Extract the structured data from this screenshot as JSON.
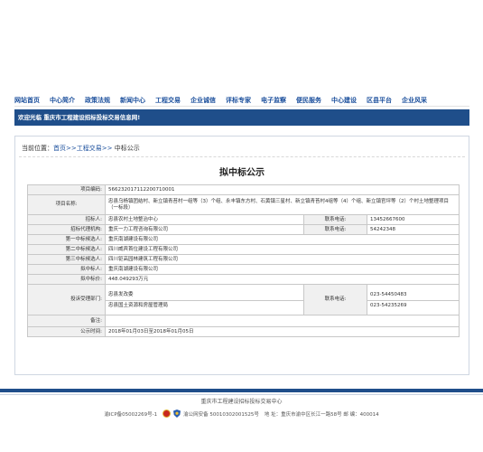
{
  "nav": {
    "items": [
      "网站首页",
      "中心简介",
      "政策法规",
      "新闻中心",
      "工程交易",
      "企业诚信",
      "评标专家",
      "电子监察",
      "便民服务",
      "中心建设",
      "区县平台",
      "企业风采"
    ]
  },
  "welcome": "欢迎光临 重庆市工程建设招标投标交易信息网!",
  "breadcrumb": {
    "prefix": "当前位置：",
    "home": "首页",
    "sep1": ">>",
    "section": "工程交易",
    "sep2": ">>",
    "current": "中标公示"
  },
  "page_title": "拟中标公示",
  "table": {
    "project_code_label": "项目编码:",
    "project_code": "566232017112200710001",
    "project_name_label": "项目名称:",
    "project_name": "忠县乌杨镇团结村、新立镇青苔村一组等（3）个组、永丰镇东方村、石黄镇三星村、新立镇青苔村4组等（4）个组、新立镇官坪等（2）个村土地整理项目（一标段）",
    "tenderer_label": "招标人:",
    "tenderer": "忠县农村土地整治中心",
    "tenderer_phone_label": "联系电话:",
    "tenderer_phone": "13452667600",
    "agency_label": "招标代理机构:",
    "agency": "重庆一力工程咨询有限公司",
    "agency_phone_label": "联系电话:",
    "agency_phone": "54242348",
    "cand1_label": "第一中标候选人:",
    "cand1": "重庆南湖建设有限公司",
    "cand2_label": "第二中标候选人:",
    "cand2": "四川威宾首位建设工程有限公司",
    "cand3_label": "第三中标候选人:",
    "cand3": "四川钜高园林建筑工程有限公司",
    "winner_label": "拟中标人:",
    "winner": "重庆南湖建设有限公司",
    "price_label": "拟中标价:",
    "price": "448.049293万元",
    "complaint_label": "投诉受理部门:",
    "complaint_dept1": "忠县发改委",
    "complaint_dept2": "忠县国土资源和房屋管理局",
    "complaint_phone_label": "联系电话:",
    "complaint_phone1": "023-54450483",
    "complaint_phone2": "023-54235269",
    "remark_label": "备注:",
    "remark": "",
    "period_label": "公示时间:",
    "period": "2018年01月03日至2018年01月05日"
  },
  "footer": {
    "org": "重庆市工程建设招标投标交易中心",
    "icp": "渝ICP备05002269号-1",
    "police": "渝公网安备 50010302001525号",
    "address": "地 址：重庆市渝中区长江一路58号 邮 编：400014"
  }
}
